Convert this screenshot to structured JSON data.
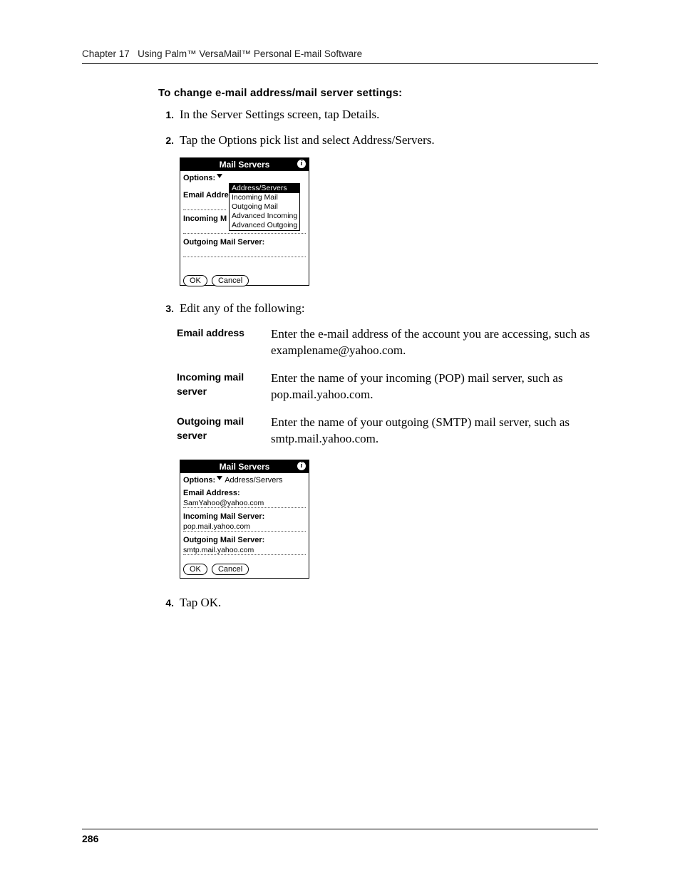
{
  "header": {
    "chapter": "Chapter 17",
    "title": "Using Palm™ VersaMail™ Personal E-mail Software"
  },
  "section_heading": "To change e-mail address/mail server settings:",
  "steps": [
    {
      "n": "1.",
      "text": "In the Server Settings screen, tap Details."
    },
    {
      "n": "2.",
      "text": "Tap the Options pick list and select Address/Servers."
    },
    {
      "n": "3.",
      "text": "Edit any of the following:"
    },
    {
      "n": "4.",
      "text": "Tap OK."
    }
  ],
  "screenshot1": {
    "title": "Mail Servers",
    "options_label": "Options:",
    "popup": [
      "Address/Servers",
      "Incoming Mail",
      "Outgoing Mail",
      "Advanced Incoming",
      "Advanced Outgoing"
    ],
    "email_label_partial": "Email Addre",
    "incoming_partial": "Incoming M",
    "outgoing_label": "Outgoing Mail Server:",
    "ok": "OK",
    "cancel": "Cancel"
  },
  "table": {
    "rows": [
      {
        "label": "Email address",
        "desc": "Enter the e-mail address of the account you are accessing, such as examplename@yahoo.com."
      },
      {
        "label": "Incoming mail server",
        "desc": "Enter the name of your incoming (POP) mail server, such as pop.mail.yahoo.com."
      },
      {
        "label": "Outgoing mail server",
        "desc": "Enter the name of your outgoing (SMTP) mail server, such as smtp.mail.yahoo.com."
      }
    ]
  },
  "screenshot2": {
    "title": "Mail Servers",
    "options_label": "Options:",
    "options_value": "Address/Servers",
    "email_label": "Email Address:",
    "email_value": "SamYahoo@yahoo.com",
    "incoming_label": "Incoming Mail Server:",
    "incoming_value": "pop.mail.yahoo.com",
    "outgoing_label": "Outgoing Mail Server:",
    "outgoing_value": "smtp.mail.yahoo.com",
    "ok": "OK",
    "cancel": "Cancel"
  },
  "page_number": "286"
}
